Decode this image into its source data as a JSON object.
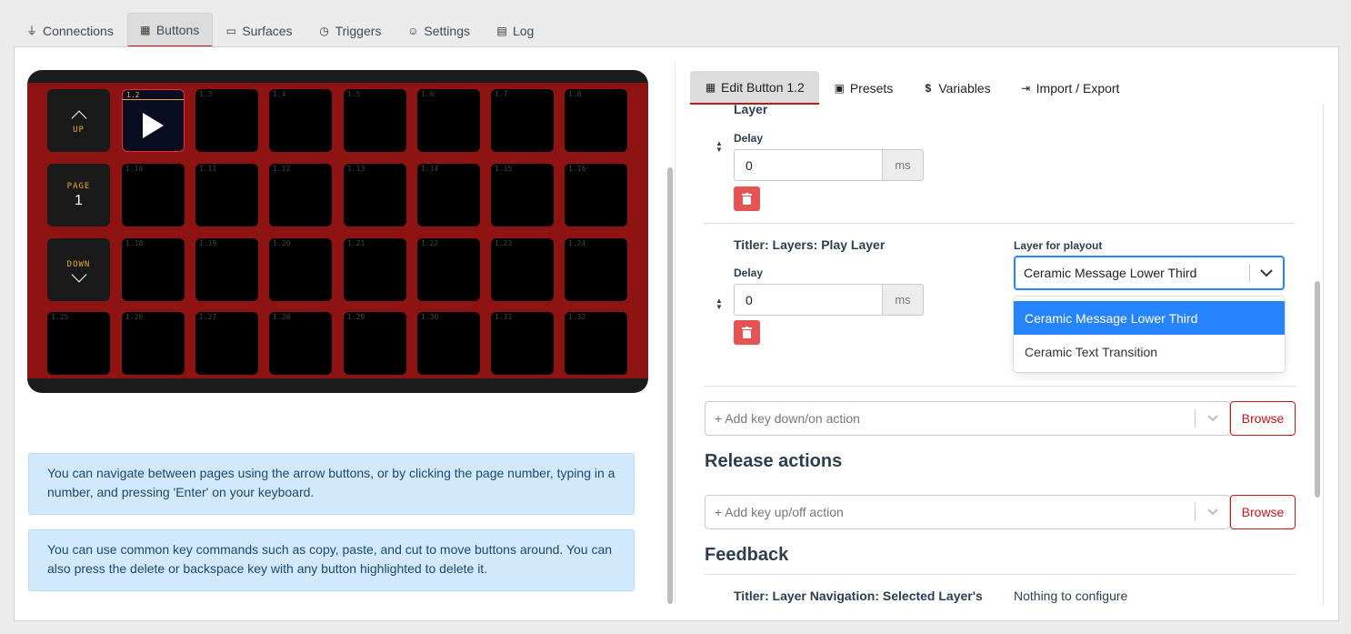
{
  "topnav": [
    {
      "label": "Connections",
      "icon": "plug-icon"
    },
    {
      "label": "Buttons",
      "icon": "calendar-grid-icon",
      "active": true
    },
    {
      "label": "Surfaces",
      "icon": "gamepad-icon"
    },
    {
      "label": "Triggers",
      "icon": "clock-icon"
    },
    {
      "label": "Settings",
      "icon": "user-cog-icon"
    },
    {
      "label": "Log",
      "icon": "clipboard-icon"
    }
  ],
  "grid": {
    "up_label": "UP",
    "page_label": "PAGE",
    "page_number": "1",
    "down_label": "DOWN",
    "selected_button": "1.2",
    "buttons": [
      "1.2",
      "1.3",
      "1.4",
      "1.5",
      "1.6",
      "1.7",
      "1.8",
      "1.10",
      "1.11",
      "1.12",
      "1.13",
      "1.14",
      "1.15",
      "1.16",
      "1.18",
      "1.19",
      "1.20",
      "1.21",
      "1.22",
      "1.23",
      "1.24",
      "1.25",
      "1.26",
      "1.27",
      "1.28",
      "1.29",
      "1.30",
      "1.31",
      "1.32"
    ]
  },
  "hints": {
    "nav": "You can navigate between pages using the arrow buttons, or by clicking the page number, typing in a number, and pressing 'Enter' on your keyboard.",
    "keys": "You can use common key commands such as copy, paste, and cut to move buttons around. You can also press the delete or backspace key with any button highlighted to delete it."
  },
  "subtabs": [
    {
      "label": "Edit Button 1.2",
      "icon": "calculator-icon",
      "active": true
    },
    {
      "label": "Presets",
      "icon": "gift-icon"
    },
    {
      "label": "Variables",
      "icon": "dollar-icon"
    },
    {
      "label": "Import / Export",
      "icon": "import-icon"
    }
  ],
  "editor": {
    "action1": {
      "title_partial": "Layer",
      "delay_label": "Delay",
      "delay_value": "0",
      "unit": "ms"
    },
    "action2": {
      "title": "Titler: Layers: Play Layer",
      "delay_label": "Delay",
      "delay_value": "0",
      "unit": "ms",
      "option_label": "Layer for playout",
      "selected": "Ceramic Message Lower Third",
      "options": [
        "Ceramic Message Lower Third",
        "Ceramic Text Transition"
      ]
    },
    "add_down_placeholder": "+ Add key down/on action",
    "browse_label": "Browse",
    "release_heading": "Release actions",
    "add_up_placeholder": "+ Add key up/off action",
    "feedback_heading": "Feedback",
    "feedback_item": {
      "title": "Titler: Layer Navigation: Selected Layer's",
      "note": "Nothing to configure"
    }
  }
}
